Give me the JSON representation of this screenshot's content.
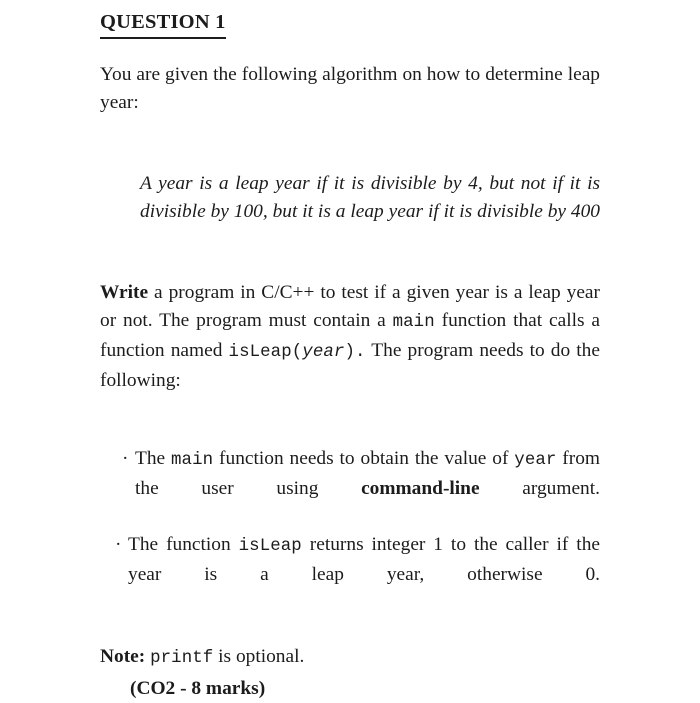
{
  "document": {
    "title": "QUESTION 1",
    "intro": {
      "text": "You are given the following algorithm on how to determine leap year:"
    },
    "quote": {
      "text": "A year is a leap year if it is divisible by 4, but not if it is divisible by 100, but it is a leap year if it is divisible by 400"
    },
    "task": {
      "part1_bold": "Write",
      "part2": " a program in C/C++ to test if a given year is a leap year or not. The program must contain a ",
      "code_main": "main",
      "part3": " function that calls a function named ",
      "code_isleap_open": "isLeap(",
      "code_year_italic": "year",
      "code_isleap_close": ").",
      "part4": " The program needs to do the following:"
    },
    "bullets": [
      {
        "marker": "·",
        "part1": "The ",
        "code1": "main",
        "part2": " function needs to obtain the value of ",
        "code2": "year",
        "part3": " from the user using ",
        "bold1": "command-line",
        "part4": " argument."
      },
      {
        "marker": "·",
        "part1": "The function ",
        "code1": "isLeap",
        "part2": " returns integer 1 to the caller if the year is a leap year, otherwise 0."
      }
    ],
    "note": {
      "label": "Note:",
      "code": "printf",
      "text": " is optional."
    },
    "marks": {
      "text": "(CO2 - 8 marks)"
    },
    "colors": {
      "text": "#1c1c1c",
      "background": "#ffffff"
    }
  }
}
